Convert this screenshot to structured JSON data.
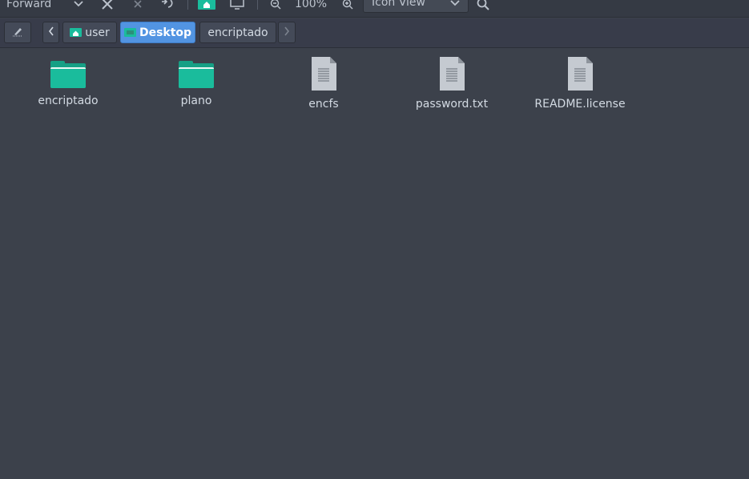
{
  "toolbar": {
    "forward_label": "Forward",
    "zoom_level": "100%",
    "view_mode": "Icon View"
  },
  "pathbar": {
    "segments": [
      {
        "label": "user",
        "icon": "home-folder-icon",
        "active": false
      },
      {
        "label": "Desktop",
        "icon": "desktop-folder-icon",
        "active": true
      },
      {
        "label": "encriptado",
        "icon": "",
        "active": false
      }
    ]
  },
  "files": [
    {
      "name": "encriptado",
      "type": "folder",
      "icon": "folder-icon"
    },
    {
      "name": "plano",
      "type": "folder",
      "icon": "folder-icon"
    },
    {
      "name": "encfs",
      "type": "file",
      "icon": "text-file-icon"
    },
    {
      "name": "password.txt",
      "type": "file",
      "icon": "text-file-icon"
    },
    {
      "name": "README.license",
      "type": "file",
      "icon": "text-file-icon"
    }
  ],
  "colors": {
    "accent": "#5294e2",
    "folder": "#1abc9c",
    "background": "#3c414b"
  }
}
